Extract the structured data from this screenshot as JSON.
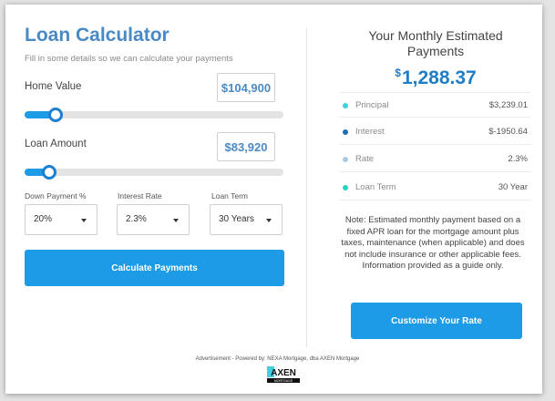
{
  "calculator": {
    "title": "Loan Calculator",
    "subtitle": "Fill in some details so we can calculate your payments",
    "home_value": {
      "label": "Home Value",
      "value": "$104,900",
      "slider_fraction": 0.12
    },
    "loan_amount": {
      "label": "Loan Amount",
      "value": "$83,920",
      "slider_fraction": 0.095
    },
    "down_payment": {
      "label": "Down Payment %",
      "selected": "20%"
    },
    "interest_rate": {
      "label": "Interest Rate",
      "selected": "2.3%"
    },
    "loan_term": {
      "label": "Loan Term",
      "selected": "30 Years"
    },
    "calculate_button": "Calculate Payments"
  },
  "results": {
    "title": "Your Monthly Estimated Payments",
    "currency_symbol": "$",
    "monthly_amount": "1,288.37",
    "rows": [
      {
        "label": "Principal",
        "value": "$3,239.01",
        "color": "#3ecfe0"
      },
      {
        "label": "Interest",
        "value": "$-1950.64",
        "color": "#1f6fb5"
      },
      {
        "label": "Rate",
        "value": "2.3%",
        "color": "#a9cbe8"
      },
      {
        "label": "Loan Term",
        "value": "30 Year",
        "color": "#2bd1c4"
      }
    ],
    "note": "Note: Estimated monthly payment based on a fixed APR loan for the mortgage amount plus taxes, maintenance (when applicable) and does not include insurance or other applicable fees. Information provided as a guide only.",
    "customize_button": "Customize Your Rate"
  },
  "footer": {
    "text": "Advertisement - Powered by: NEXA Mortgage, dba AXEN Mortgage",
    "logo_text": "AXEN",
    "logo_subtext": "MORTGAGE"
  },
  "colors": {
    "accent": "#1d9be6",
    "title_blue": "#4a8ac4",
    "amount_blue": "#1f7ec6"
  }
}
